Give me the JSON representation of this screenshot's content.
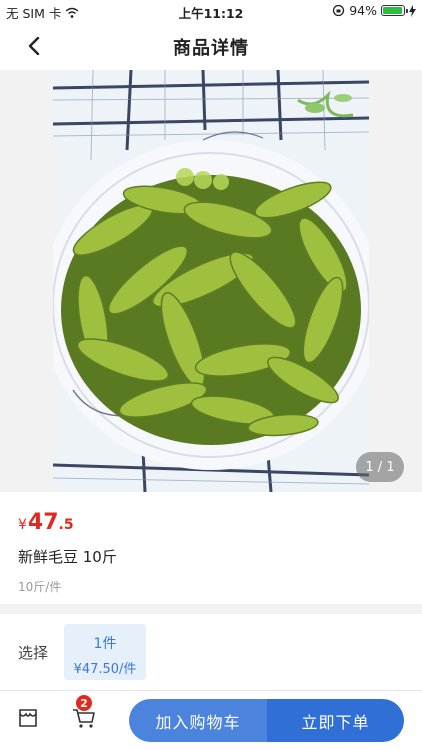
{
  "status_bar": {
    "carrier": "无 SIM 卡",
    "time": "上午11:12",
    "battery_percent": "94%",
    "battery_level": 0.94
  },
  "header": {
    "title": "商品详情"
  },
  "gallery": {
    "pager": "1 / 1"
  },
  "product": {
    "currency": "¥",
    "price_integer": "47",
    "price_decimal": ".5",
    "name": "新鲜毛豆 10斤",
    "unit": "10斤/件"
  },
  "options": {
    "label": "选择",
    "sku_qty": "1件",
    "sku_price": "¥47.50/件"
  },
  "bottom_bar": {
    "cart_badge": "2",
    "add_to_cart": "加入购物车",
    "buy_now": "立即下单"
  },
  "colors": {
    "price": "#e02a1f",
    "primary": "#2f6fd6",
    "secondary": "#4b83dd"
  }
}
